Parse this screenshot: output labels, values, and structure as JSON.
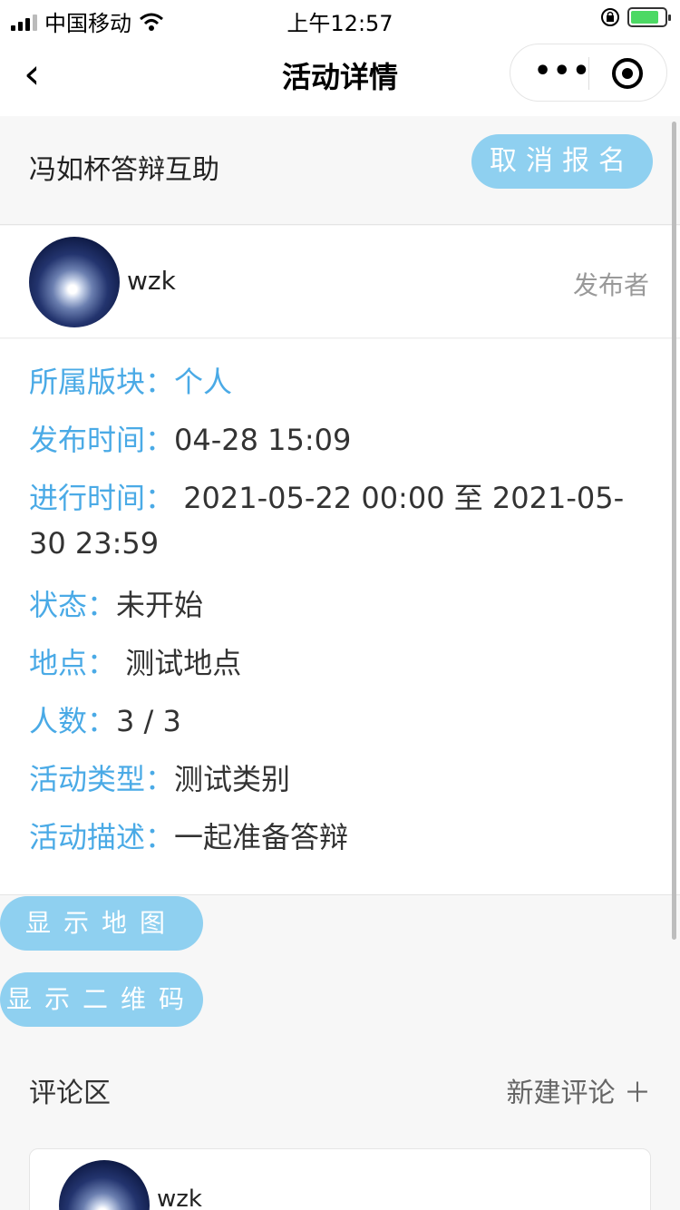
{
  "status_bar": {
    "carrier": "中国移动",
    "time": "上午12:57"
  },
  "nav": {
    "back": "‹",
    "title": "活动详情"
  },
  "activity": {
    "name": "冯如杯答辩互助",
    "cancel_button": "取消报名"
  },
  "publisher": {
    "name": "wzk",
    "role": "发布者"
  },
  "details": {
    "section_label": "所属版块：",
    "section_value": "个人",
    "publish_time_label": "发布时间：",
    "publish_time_value": "04-28 15:09",
    "duration_label": "进行时间：",
    "duration_value": " 2021-05-22 00:00 至 2021-05-30 23:59",
    "status_label": "状态：",
    "status_value": "未开始",
    "location_label": "地点：",
    "location_value": " 测试地点",
    "people_label": "人数：",
    "people_value": "3 / 3",
    "type_label": "活动类型：",
    "type_value": "测试类别",
    "desc_label": "活动描述：",
    "desc_value": "一起准备答辩"
  },
  "buttons": {
    "map": "显示地图",
    "qrcode": "显示二维码"
  },
  "comments": {
    "title": "评论区",
    "new": "新建评论 ＋",
    "first_user": "wzk"
  }
}
